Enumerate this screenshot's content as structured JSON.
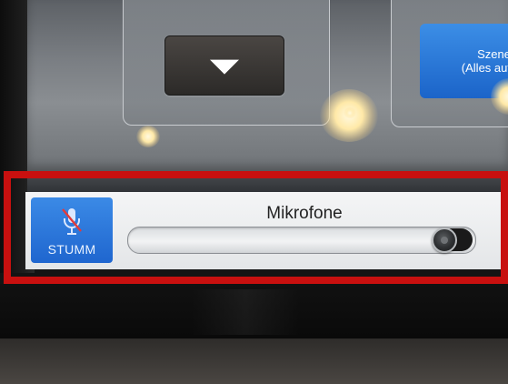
{
  "touch_panel": {
    "upper_controls": {
      "down_button_icon": "triangle-down-icon",
      "scene_button": {
        "line1": "Szene",
        "line2": "(Alles auf"
      }
    },
    "mic_control": {
      "mute_button": {
        "icon": "microphone-muted-icon",
        "label": "STUMM",
        "active": true
      },
      "slider": {
        "label": "Mikrofone",
        "level_percent": 96
      }
    },
    "highlight_color": "#c8100f",
    "accent_color": "#1f66cf"
  }
}
